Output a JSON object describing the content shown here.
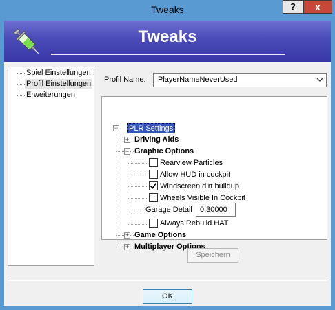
{
  "window": {
    "title": "Tweaks",
    "help_label": "?",
    "close_label": "x"
  },
  "banner": {
    "title": "Tweaks",
    "logo_icon": "syringe-icon"
  },
  "nav": {
    "items": [
      {
        "label": "Spiel Einstellungen",
        "selected": false
      },
      {
        "label": "Profil Einstellungen",
        "selected": true
      },
      {
        "label": "Erweiterungen",
        "selected": false
      }
    ]
  },
  "profile": {
    "label": "Profil Name:",
    "value": "PlayerNameNeverUsed"
  },
  "tree": {
    "root": "PLR Settings",
    "driving_aids": "Driving Aids",
    "graphic_options": "Graphic Options",
    "options": [
      {
        "label": "Rearview Particles",
        "checked": false
      },
      {
        "label": "Allow HUD in cockpit",
        "checked": false
      },
      {
        "label": "Windscreen dirt buildup",
        "checked": true
      },
      {
        "label": "Wheels Visible In Cockpit",
        "checked": false
      }
    ],
    "garage_detail_label": "Garage Detail",
    "garage_detail_value": "0.30000",
    "always_rebuild": {
      "label": "Always Rebuild HAT",
      "checked": false
    },
    "game_options": "Game Options",
    "multiplayer_options": "Multiplayer Options",
    "expand_symbol": "+",
    "collapse_symbol": "−"
  },
  "buttons": {
    "save": "Speichern",
    "ok": "OK"
  },
  "colors": {
    "title_bar": "#5a9ad2",
    "banner": "#4a4ab8",
    "close_button": "#c7473b",
    "selection": "#3355bb"
  }
}
